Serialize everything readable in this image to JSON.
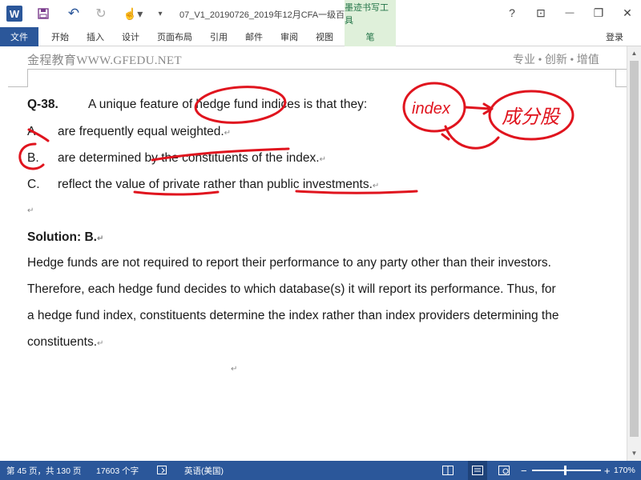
{
  "app": {
    "logo": "W",
    "doc_title": "07_V1_20190726_2019年12月CFA一级百题...",
    "context_tab_title": "墨迹书写工具",
    "quick_access": {
      "save_icon": "save-icon",
      "undo": "↶",
      "redo": "↻",
      "touch": "☝▾",
      "customize": "▾"
    },
    "window": {
      "help": "?",
      "ribbon_display": "⊡",
      "minimize": "—",
      "restore": "❐",
      "close": "✕"
    }
  },
  "ribbon": {
    "file": "文件",
    "tabs": [
      "开始",
      "插入",
      "设计",
      "页面布局",
      "引用",
      "邮件",
      "审阅",
      "视图"
    ],
    "context_tab": "笔",
    "login": "登录"
  },
  "document": {
    "header_left": "金程教育WWW.GFEDU.NET",
    "header_right": "专业 • 创新 • 增值",
    "question": {
      "number": "Q-38.",
      "stem": "A unique feature of hedge fund indices is that they:",
      "options": [
        {
          "letter": "A.",
          "text": "are frequently equal weighted."
        },
        {
          "letter": "B.",
          "text": "are determined by the constituents of the index."
        },
        {
          "letter": "C.",
          "text": "reflect the value of private rather than public investments."
        }
      ]
    },
    "solution_heading": "Solution: B.",
    "solution_lines": [
      "Hedge funds are not required to report their performance to any party other than their investors.",
      "Therefore, each hedge fund decides to which database(s) it will report its performance. Thus, for",
      "a hedge fund index, constituents determine the index rather than index providers determining the",
      "constituents."
    ],
    "paragraph_mark": "↵",
    "ink_annotation_words": [
      "index",
      "成分股"
    ]
  },
  "statusbar": {
    "page": "第 45 页，共 130 页",
    "words": "17603 个字",
    "proof_icon": "proofing-icon",
    "language": "英语(美国)",
    "zoom": "170%",
    "zoom_minus": "−",
    "zoom_plus": "+"
  },
  "colors": {
    "accent": "#2b579a",
    "ink": "#e0141e",
    "context_tab": "#dff0da"
  }
}
